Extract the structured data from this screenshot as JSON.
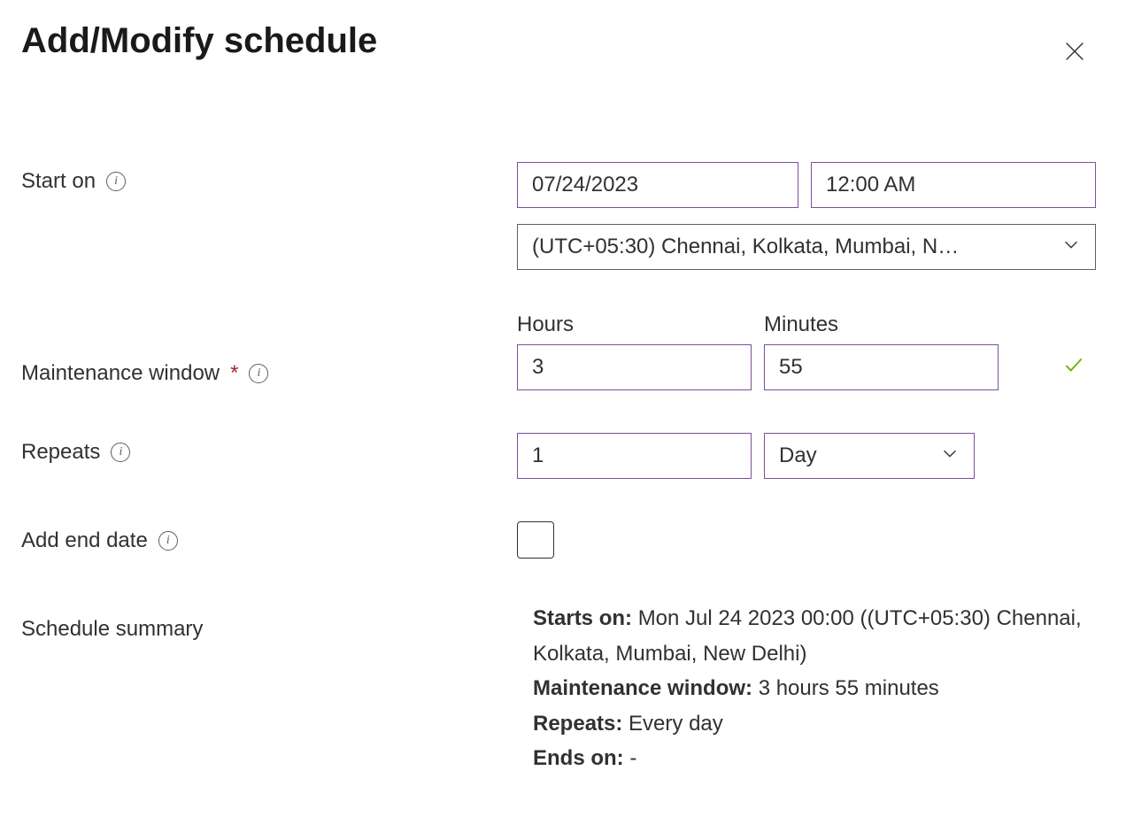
{
  "title": "Add/Modify schedule",
  "labels": {
    "start_on": "Start on",
    "maintenance_window": "Maintenance window",
    "repeats": "Repeats",
    "add_end_date": "Add end date",
    "schedule_summary": "Schedule summary",
    "hours": "Hours",
    "minutes": "Minutes"
  },
  "fields": {
    "start_date": "07/24/2023",
    "start_time": "12:00 AM",
    "timezone": "(UTC+05:30) Chennai, Kolkata, Mumbai, N…",
    "hours": "3",
    "minutes": "55",
    "repeat_count": "1",
    "repeat_unit": "Day",
    "add_end_date_checked": false
  },
  "summary": {
    "starts_on_label": "Starts on:",
    "starts_on_value": "Mon Jul 24 2023 00:00 ((UTC+05:30) Chennai, Kolkata, Mumbai, New Delhi)",
    "maintenance_window_label": "Maintenance window:",
    "maintenance_window_value": "3 hours 55 minutes",
    "repeats_label": "Repeats:",
    "repeats_value": "Every day",
    "ends_on_label": "Ends on:",
    "ends_on_value": "-"
  }
}
